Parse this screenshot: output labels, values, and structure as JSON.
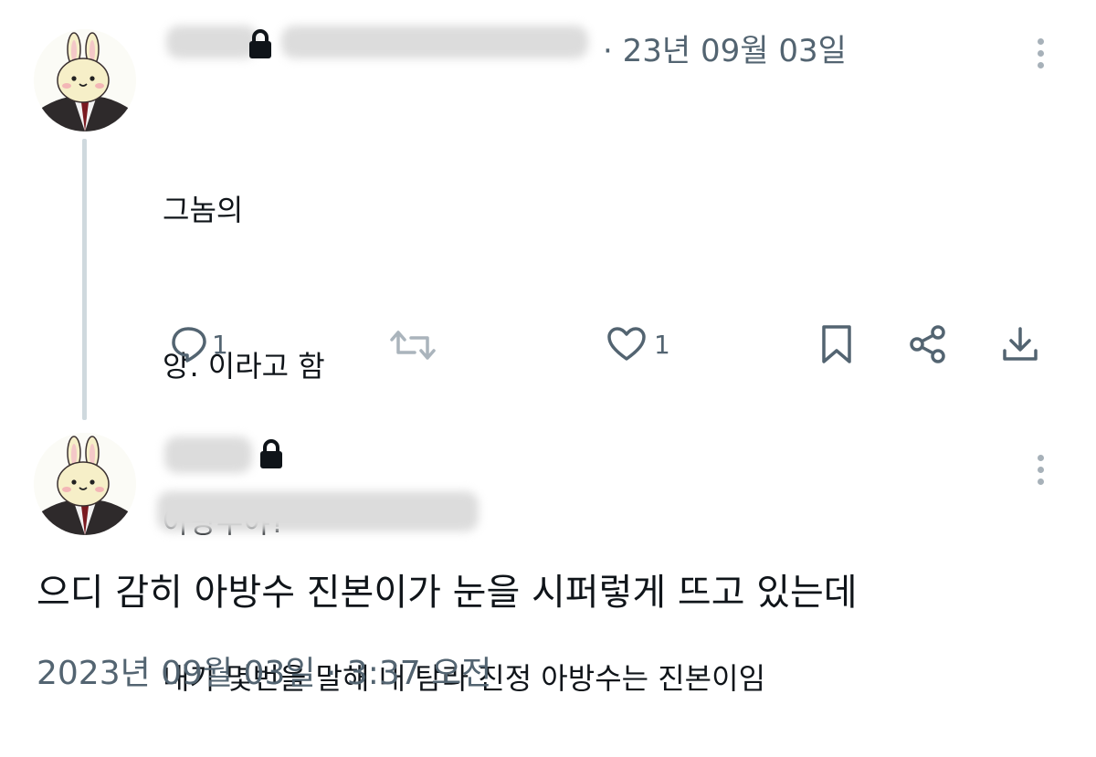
{
  "tweet": {
    "date": "· 23년 09월 03일",
    "lines": [
      "그놈의",
      "앙. 이라고 함",
      "아방수야?",
      "내가 몇번을 말해 내 탐라 진정 아방수는 진본이임"
    ],
    "reply_count": "1",
    "like_count": "1"
  },
  "reply": {
    "text": "으디 감히 아방수 진본이가 눈을 시퍼렇게 뜨고 있는데",
    "timestamp": "2023년 09월 03일 · 3:37 오전"
  },
  "icons": [
    "reply-icon",
    "retweet-icon",
    "like-icon",
    "bookmark-icon",
    "share-icon",
    "download-icon",
    "lock-icon",
    "more-icon"
  ],
  "colors": {
    "text": "#0f1419",
    "muted": "#536471",
    "thread_line": "#cfd9de",
    "lock": "#0f1419"
  }
}
